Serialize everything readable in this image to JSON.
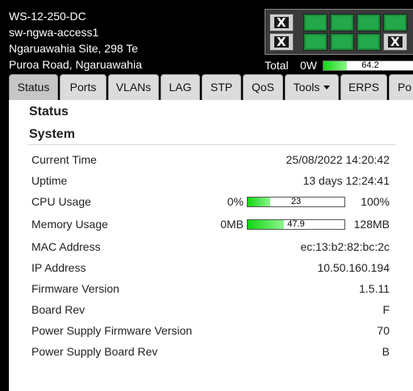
{
  "device": {
    "name": "WS-12-250-DC",
    "hostname": "sw-ngwa-access1",
    "location_line1": "Ngaruawahia Site, 298 Te",
    "location_line2": "Puroa Road, Ngaruawahia"
  },
  "ports": {
    "top_row": [
      {
        "status": "down",
        "mark": "X"
      },
      {
        "status": "up",
        "mark": ""
      },
      {
        "status": "up",
        "mark": ""
      },
      {
        "status": "up",
        "mark": ""
      },
      {
        "status": "up",
        "mark": ""
      }
    ],
    "bottom_row": [
      {
        "status": "down",
        "mark": "X"
      },
      {
        "status": "up",
        "mark": ""
      },
      {
        "status": "up",
        "mark": ""
      },
      {
        "status": "up",
        "mark": ""
      },
      {
        "status": "down",
        "mark": "X"
      }
    ]
  },
  "power": {
    "total_label": "Total",
    "current": "0W",
    "bar_value": "64.2",
    "bar_fraction": 0.25
  },
  "tabs": [
    {
      "label": "Status",
      "active": true
    },
    {
      "label": "Ports"
    },
    {
      "label": "VLANs"
    },
    {
      "label": "LAG"
    },
    {
      "label": "STP"
    },
    {
      "label": "QoS"
    },
    {
      "label": "Tools",
      "dropdown": true
    },
    {
      "label": "ERPS"
    },
    {
      "label": "Po"
    }
  ],
  "page": {
    "section_title": "Status",
    "subsection_title": "System"
  },
  "system": {
    "current_time": {
      "label": "Current Time",
      "value": "25/08/2022 14:20:42"
    },
    "uptime": {
      "label": "Uptime",
      "value": "13 days 12:24:41"
    },
    "cpu": {
      "label": "CPU Usage",
      "min": "0%",
      "value": "23",
      "max": "100%",
      "fraction": 0.23
    },
    "memory": {
      "label": "Memory Usage",
      "min": "0MB",
      "value": "47.9",
      "max": "128MB",
      "fraction": 0.374
    },
    "mac": {
      "label": "MAC Address",
      "value": "ec:13:b2:82:bc:2c"
    },
    "ip": {
      "label": "IP Address",
      "value": "10.50.160.194"
    },
    "firmware": {
      "label": "Firmware Version",
      "value": "1.5.11"
    },
    "board_rev": {
      "label": "Board Rev",
      "value": "F"
    },
    "psu_firmware": {
      "label": "Power Supply Firmware Version",
      "value": "70"
    },
    "psu_board_rev": {
      "label": "Power Supply Board Rev",
      "value": "B"
    }
  },
  "colors": {
    "port_up": "#23a84a",
    "bar_fill": "#11d611",
    "header_bg": "#000000",
    "panel_bg": "#ffffff"
  }
}
